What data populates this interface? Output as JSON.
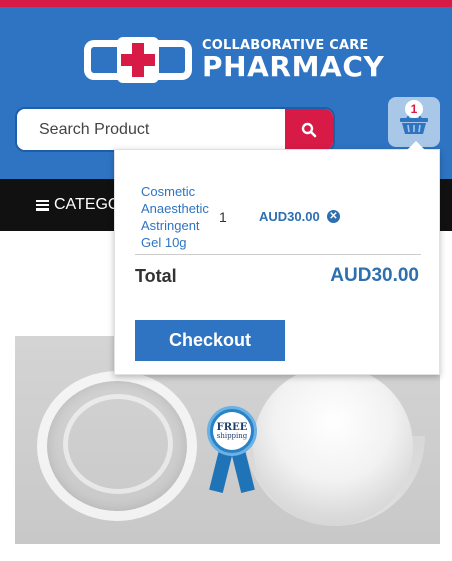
{
  "brand": {
    "line1": "COLLABORATIVE CARE",
    "line2": "PHARMACY"
  },
  "search": {
    "placeholder": "Search Product",
    "value": ""
  },
  "cart": {
    "count": "1",
    "items": [
      {
        "name": "Cosmetic Anaesthetic Astringent Gel 10g",
        "quantity": "1",
        "price": "AUD30.00"
      }
    ],
    "total_label": "Total",
    "total_value": "AUD30.00",
    "checkout_label": "Checkout"
  },
  "nav": {
    "categories_label": "CATEGO"
  },
  "product_badge": {
    "line1": "FREE",
    "line2": "shipping"
  },
  "colors": {
    "primary": "#2e74c2",
    "accent": "#d81b46",
    "nav": "#111111"
  }
}
